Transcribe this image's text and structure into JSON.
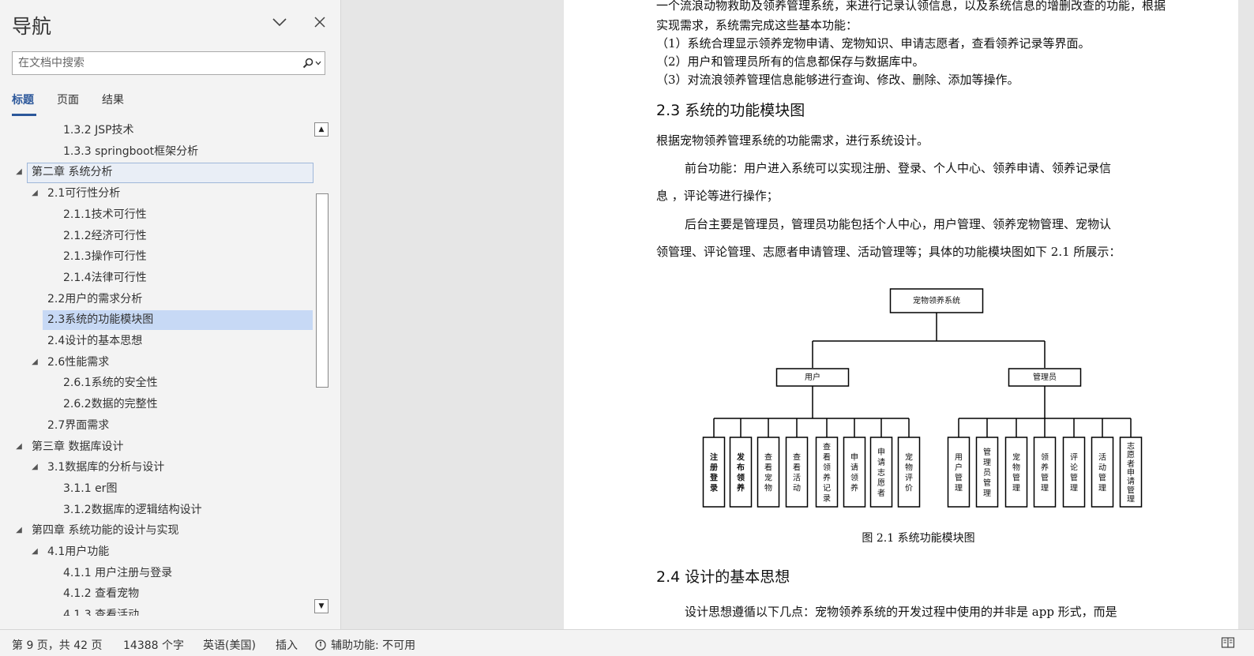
{
  "nav": {
    "title": "导航",
    "search_placeholder": "在文档中搜索",
    "tabs": [
      {
        "label": "标题",
        "active": true
      },
      {
        "label": "页面",
        "active": false
      },
      {
        "label": "结果",
        "active": false
      }
    ],
    "items": [
      {
        "label": "1.3.2  JSP技术",
        "level": 3
      },
      {
        "label": "1.3.3  springboot框架分析",
        "level": 3
      },
      {
        "label": "第二章 系统分析",
        "level": 1,
        "expanded": true,
        "outlined": true
      },
      {
        "label": "2.1可行性分析",
        "level": 2,
        "expanded": true
      },
      {
        "label": "2.1.1技术可行性",
        "level": 3
      },
      {
        "label": "2.1.2经济可行性",
        "level": 3
      },
      {
        "label": "2.1.3操作可行性",
        "level": 3
      },
      {
        "label": "2.1.4法律可行性",
        "level": 3
      },
      {
        "label": "2.2用户的需求分析",
        "level": 2
      },
      {
        "label": "2.3系统的功能模块图",
        "level": 2,
        "selected": true
      },
      {
        "label": "2.4设计的基本思想",
        "level": 2
      },
      {
        "label": "2.6性能需求",
        "level": 2,
        "expanded": true
      },
      {
        "label": "2.6.1系统的安全性",
        "level": 3
      },
      {
        "label": "2.6.2数据的完整性",
        "level": 3
      },
      {
        "label": "2.7界面需求",
        "level": 2
      },
      {
        "label": "第三章 数据库设计",
        "level": 1,
        "expanded": true
      },
      {
        "label": "3.1数据库的分析与设计",
        "level": 2,
        "expanded": true
      },
      {
        "label": "3.1.1 er图",
        "level": 3
      },
      {
        "label": "3.1.2数据库的逻辑结构设计",
        "level": 3
      },
      {
        "label": "第四章 系统功能的设计与实现",
        "level": 1,
        "expanded": true
      },
      {
        "label": "4.1用户功能",
        "level": 2,
        "expanded": true
      },
      {
        "label": "4.1.1 用户注册与登录",
        "level": 3
      },
      {
        "label": "4.1.2 查看宠物",
        "level": 3
      },
      {
        "label": "4.1.3 查看活动",
        "level": 3
      }
    ]
  },
  "doc": {
    "intro_lines": [
      "一个流浪动物救助及领养管理系统，来进行记录认领信息，以及系统信息的增删改查的功能，根据",
      "实现需求，系统需完成这些基本功能：",
      "（1）系统合理显示领养宠物申请、宠物知识、申请志愿者，查看领养记录等界面。",
      "（2）用户和管理员所有的信息都保存与数据库中。",
      "（3）对流浪领养管理信息能够进行查询、修改、删除、添加等操作。"
    ],
    "heading_23": "2.3 系统的功能模块图",
    "para1": "根据宠物领养管理系统的功能需求，进行系统设计。",
    "para2_l1": "前台功能：用户进入系统可以实现注册、登录、个人中心、领养申请、领养记录信",
    "para2_l2": "息 ，评论等进行操作；",
    "para3_l1": "后台主要是管理员，管理员功能包括个人中心，用户管理、领养宠物管理、宠物认",
    "para3_l2": "领管理、评论管理、志愿者申请管理、活动管理等；具体的功能模块图如下 2.1 所展示：",
    "diagram": {
      "root": "宠物领养系统",
      "user": "用户",
      "admin": "管理员",
      "user_modules": [
        "注册登录",
        "发布领养",
        "查看宠物",
        "查看活动",
        "查看领养记录",
        "申请领养",
        "申请志愿者",
        "宠物评价"
      ],
      "admin_modules": [
        "用户管理",
        "管理员管理",
        "宠物管理",
        "领养管理",
        "评论管理",
        "活动管理",
        "志愿者申请管理"
      ]
    },
    "caption": "图 2.1 系统功能模块图",
    "heading_24": "2.4 设计的基本思想",
    "para4": "设计思想遵循以下几点：宠物领养系统的开发过程中使用的并非是 app 形式，而是"
  },
  "status": {
    "page": "第 9 页，共 42 页",
    "words": "14388 个字",
    "lang": "英语(美国)",
    "mode": "插入",
    "accessibility": "辅助功能: 不可用"
  }
}
